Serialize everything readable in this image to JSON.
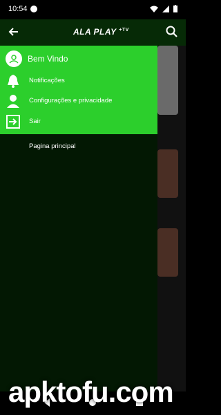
{
  "status": {
    "time": "10:54"
  },
  "appbar": {
    "logo_main": "ALA PLAY",
    "logo_suffix": "+TV"
  },
  "drawer": {
    "welcome": "Bem Vindo",
    "items": [
      {
        "label": "Notificações",
        "icon": "bell-icon"
      },
      {
        "label": "Configurações e privacidade",
        "icon": "person-icon"
      },
      {
        "label": "Sair",
        "icon": "exit-icon"
      }
    ],
    "main_link": "Pagina principal"
  },
  "watermark": "apktofu.com",
  "colors": {
    "drawer_header": "#2ccf2c",
    "drawer_bg": "#031803",
    "appbar_bg": "#062a06"
  }
}
